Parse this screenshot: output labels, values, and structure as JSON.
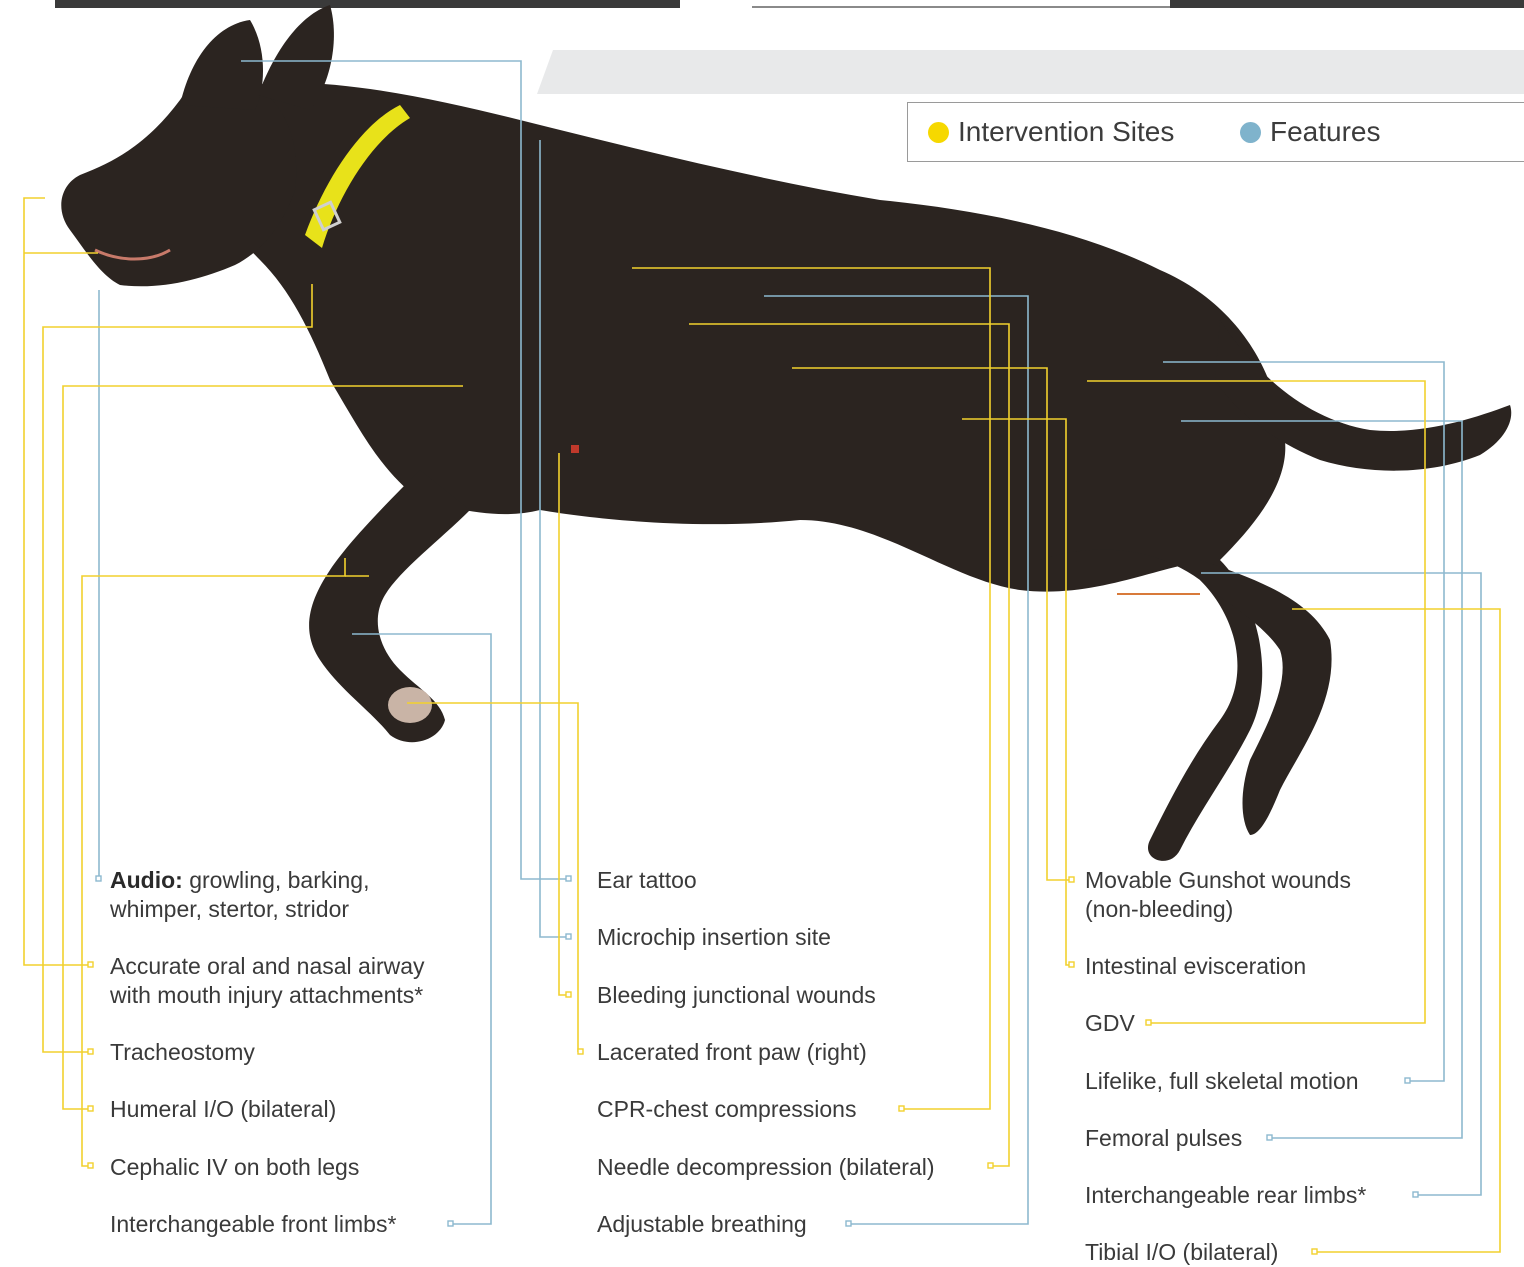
{
  "legend": {
    "intervention": {
      "label": "Intervention Sites",
      "color": "#f6d800"
    },
    "features": {
      "label": "Features",
      "color": "#7fb3cc"
    }
  },
  "colors": {
    "intervention_line": "#f2d12e",
    "feature_line": "#8db9cf",
    "dog_fur": "#2b2420",
    "collar": "#e8e21a"
  },
  "labels": {
    "audio_bold": "Audio:",
    "audio_rest": "growling, barking,",
    "audio_line2": "whimper, stertor, stridor",
    "airway_line1": "Accurate oral and nasal airway",
    "airway_line2": "with mouth injury attachments*",
    "tracheostomy": "Tracheostomy",
    "humeral": "Humeral I/O (bilateral)",
    "cephalic": "Cephalic IV on both legs",
    "front_limbs": "Interchangeable front limbs*",
    "ear_tattoo": "Ear tattoo",
    "microchip": "Microchip insertion site",
    "bleeding_junctional": "Bleeding junctional wounds",
    "lacerated_paw": "Lacerated front paw (right)",
    "cpr": "CPR-chest compressions",
    "needle_decompression": "Needle decompression (bilateral)",
    "adjustable_breathing": "Adjustable breathing",
    "gunshot_line1": "Movable Gunshot wounds",
    "gunshot_line2": "(non-bleeding)",
    "evisceration": "Intestinal evisceration",
    "gdv": "GDV",
    "skeletal_motion": "Lifelike, full skeletal motion",
    "femoral_pulses": "Femoral pulses",
    "rear_limbs": "Interchangeable rear limbs*",
    "tibial": "Tibial I/O (bilateral)"
  }
}
